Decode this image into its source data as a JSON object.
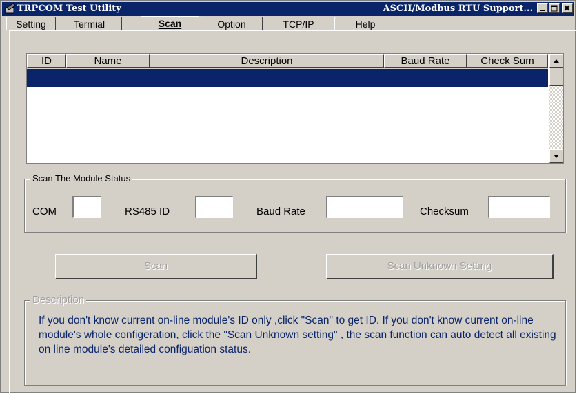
{
  "window": {
    "title": "TRPCOM Test Utility",
    "title_right": "ASCII/Modbus RTU Support...",
    "colors": {
      "titlebar": "#0a246a",
      "face": "#d4d0c8",
      "selection": "#0a246a",
      "description_text": "#0a246a"
    }
  },
  "tabs": [
    {
      "label": "Setting",
      "active": false
    },
    {
      "label": "Termial",
      "active": false
    },
    {
      "label": "Scan",
      "active": true
    },
    {
      "label": "Option",
      "active": false
    },
    {
      "label": "TCP/IP",
      "active": false
    },
    {
      "label": "Help",
      "active": false
    }
  ],
  "list": {
    "columns": [
      "ID",
      "Name",
      "Description",
      "Baud Rate",
      "Check Sum"
    ],
    "selected_row": 0
  },
  "scan_status": {
    "legend": "Scan The Module Status",
    "com_label": "COM",
    "com_value": "",
    "rs485_label": "RS485 ID",
    "rs485_value": "",
    "baud_label": "Baud Rate",
    "baud_value": "",
    "checksum_label": "Checksum",
    "checksum_value": ""
  },
  "buttons": {
    "scan": "Scan",
    "scan_unknown": "Scan Unknown Setting"
  },
  "description": {
    "legend": "Description",
    "text": "If you don't know current on-line module's ID only ,click \"Scan\" to get ID. If you don't know current on-line module's whole configeration, click the \"Scan Unknown setting\" , the scan function can auto detect all existing on line module's  detailed configuation status."
  },
  "icons": [
    "app-icon",
    "minimize-icon",
    "maximize-icon",
    "close-icon",
    "scroll-up-icon",
    "scroll-down-icon"
  ]
}
